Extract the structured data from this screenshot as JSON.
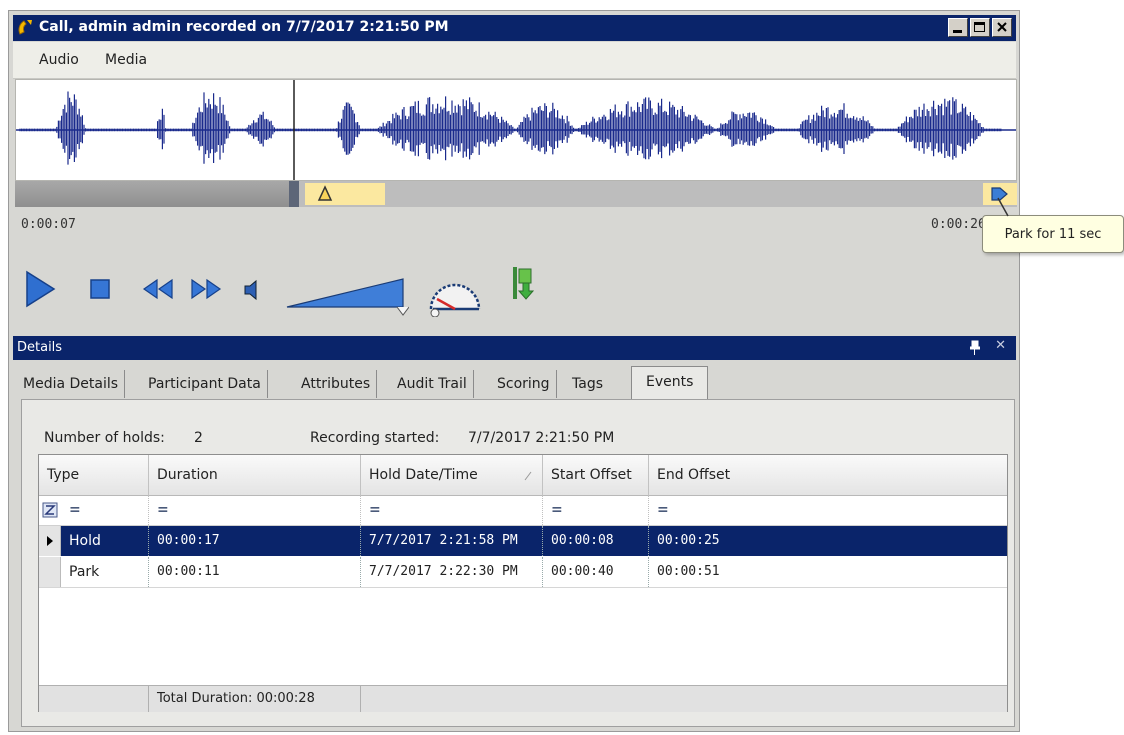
{
  "window": {
    "title": "Call, admin admin recorded on 7/7/2017 2:21:50 PM",
    "title_color": "#0a246a"
  },
  "menu": [
    "Audio",
    "Media"
  ],
  "playback": {
    "time_start": "0:00:07",
    "time_end": "0:00:26",
    "tooltip": "Park for 11 sec"
  },
  "controls": [
    "play-icon",
    "stop-icon",
    "rewind-icon",
    "fast-forward-icon",
    "speaker-icon",
    "volume-slider",
    "speed-gauge-icon",
    "export-icon"
  ],
  "details": {
    "header": "Details",
    "tabs": [
      "Media Details",
      "Participant Data",
      "Attributes",
      "Audit Trail",
      "Scoring",
      "Tags",
      "Events"
    ],
    "active_tab": "Events",
    "holds_label": "Number of holds:",
    "holds_value": "2",
    "recording_label": "Recording started:",
    "recording_value": "7/7/2017 2:21:50 PM",
    "columns": [
      "Type",
      "Duration",
      "Hold Date/Time",
      "Start Offset",
      "End Offset"
    ],
    "filter_symbol": "=",
    "rows": [
      {
        "type": "Hold",
        "duration": "00:00:17",
        "datetime": "7/7/2017 2:21:58 PM",
        "start": "00:00:08",
        "end": "00:00:25"
      },
      {
        "type": "Park",
        "duration": "00:00:11",
        "datetime": "7/7/2017 2:22:30 PM",
        "start": "00:00:40",
        "end": "00:00:51"
      }
    ],
    "total": "Total Duration: 00:00:28"
  }
}
